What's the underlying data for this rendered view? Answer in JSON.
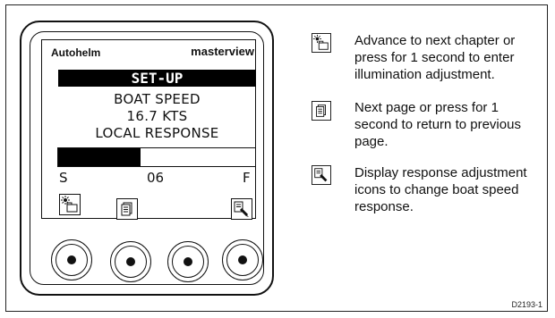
{
  "device": {
    "brand_left": "Autohelm",
    "brand_right": "masterview",
    "screen_title": "SET-UP",
    "line1": "BOAT SPEED",
    "line2": "16.7 KTS",
    "line3": "LOCAL RESPONSE",
    "bar_fill_fraction": 0.42,
    "scale_left": "S",
    "scale_value": "06",
    "scale_right": "F"
  },
  "legend": [
    {
      "icon": "illumination-chapter-icon",
      "text": "Advance to next chapter or press for 1 second to enter illumination adjustment."
    },
    {
      "icon": "page-icon",
      "text": "Next page or press for 1 second to return to previous page."
    },
    {
      "icon": "response-adjust-icon",
      "text": "Display response adjustment icons to change boat speed response."
    }
  ],
  "figure_ref": "D2193-1"
}
